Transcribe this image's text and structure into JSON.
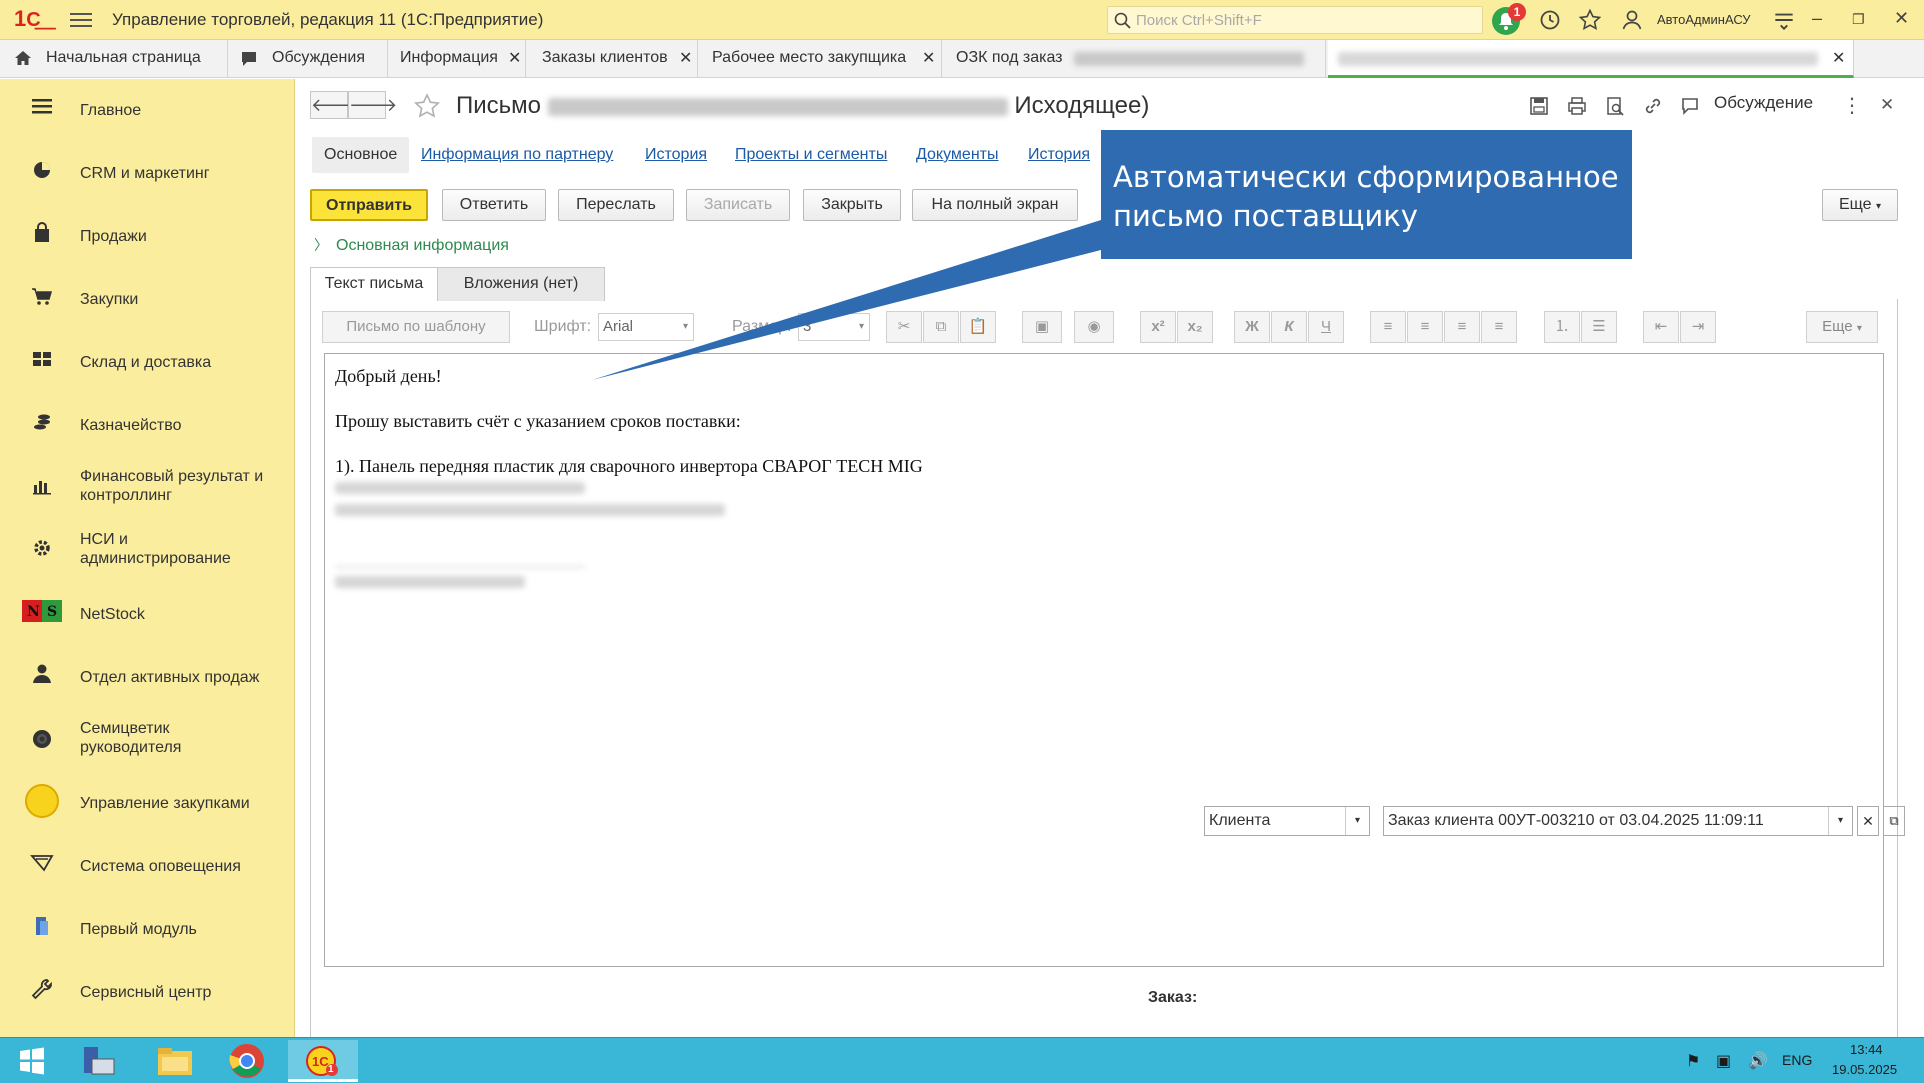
{
  "titlebar": {
    "app_title": "Управление торговлей, редакция 11  (1С:Предприятие)",
    "search_placeholder": "Поиск Ctrl+Shift+F",
    "notifications_count": "1",
    "user_name": "АвтоАдминАСУ"
  },
  "tabs": [
    {
      "label": "Начальная страница"
    },
    {
      "label": "Обсуждения"
    },
    {
      "label": "Информация"
    },
    {
      "label": "Заказы клиентов"
    },
    {
      "label": "Рабочее место закупщика"
    },
    {
      "label": "ОЗК под заказ"
    }
  ],
  "sidebar": {
    "items": [
      {
        "label": "Главное",
        "icon": "menu-icon"
      },
      {
        "label": "CRM и маркетинг",
        "icon": "pie-chart-icon"
      },
      {
        "label": "Продажи",
        "icon": "shopping-bag-icon"
      },
      {
        "label": "Закупки",
        "icon": "cart-icon"
      },
      {
        "label": "Склад и доставка",
        "icon": "warehouse-icon"
      },
      {
        "label": "Казначейство",
        "icon": "coins-icon"
      },
      {
        "label": "Финансовый результат и контроллинг",
        "icon": "bar-chart-icon"
      },
      {
        "label": "НСИ и администрирование",
        "icon": "gear-icon"
      },
      {
        "label": "NetStock",
        "icon": "netstock-icon"
      },
      {
        "label": "Отдел активных продаж",
        "icon": "person-icon"
      },
      {
        "label": "Семицветик руководителя",
        "icon": "flower-icon"
      },
      {
        "label": "Управление закупками",
        "icon": "circle-icon"
      },
      {
        "label": "Система оповещения",
        "icon": "funnel-icon"
      },
      {
        "label": "Первый модуль",
        "icon": "module-icon"
      },
      {
        "label": "Сервисный центр",
        "icon": "wrench-icon"
      }
    ]
  },
  "document": {
    "title_prefix": "Письмо",
    "title_suffix": "Исходящее)",
    "discussion_label": "Обсуждение",
    "subtabs": [
      "Основное",
      "Информация по партнеру",
      "История",
      "Проекты и сегменты",
      "Документы",
      "История"
    ],
    "buttons": {
      "send": "Отправить",
      "reply": "Ответить",
      "forward": "Переслать",
      "save": "Записать",
      "close": "Закрыть",
      "fullscreen": "На полный экран",
      "more": "Еще"
    },
    "section_main_info": "Основная информация",
    "form_tabs": [
      "Текст письма",
      "Вложения (нет)"
    ],
    "toolbar": {
      "template_button": "Письмо по шаблону",
      "font_label": "Шрифт:",
      "font_value": "Arial",
      "size_label": "Размер:",
      "size_value": "3",
      "more": "Еще"
    },
    "body": {
      "greeting": "Добрый день!",
      "request": "Прошу выставить счёт с указанием сроков поставки:",
      "item1": "1). Панель передняя пластик для сварочного инвертора СВАРОГ TECH MIG"
    },
    "order": {
      "label": "Заказ:",
      "type_value": "Клиента",
      "order_value": "Заказ клиента 00УТ-003210 от 03.04.2025 11:09:11"
    }
  },
  "callout": {
    "text_line1": "Автоматически сформированное",
    "text_line2": "письмо поставщику"
  },
  "taskbar": {
    "language": "ENG",
    "time": "13:44",
    "date": "19.05.2025",
    "app_badge": "1"
  }
}
